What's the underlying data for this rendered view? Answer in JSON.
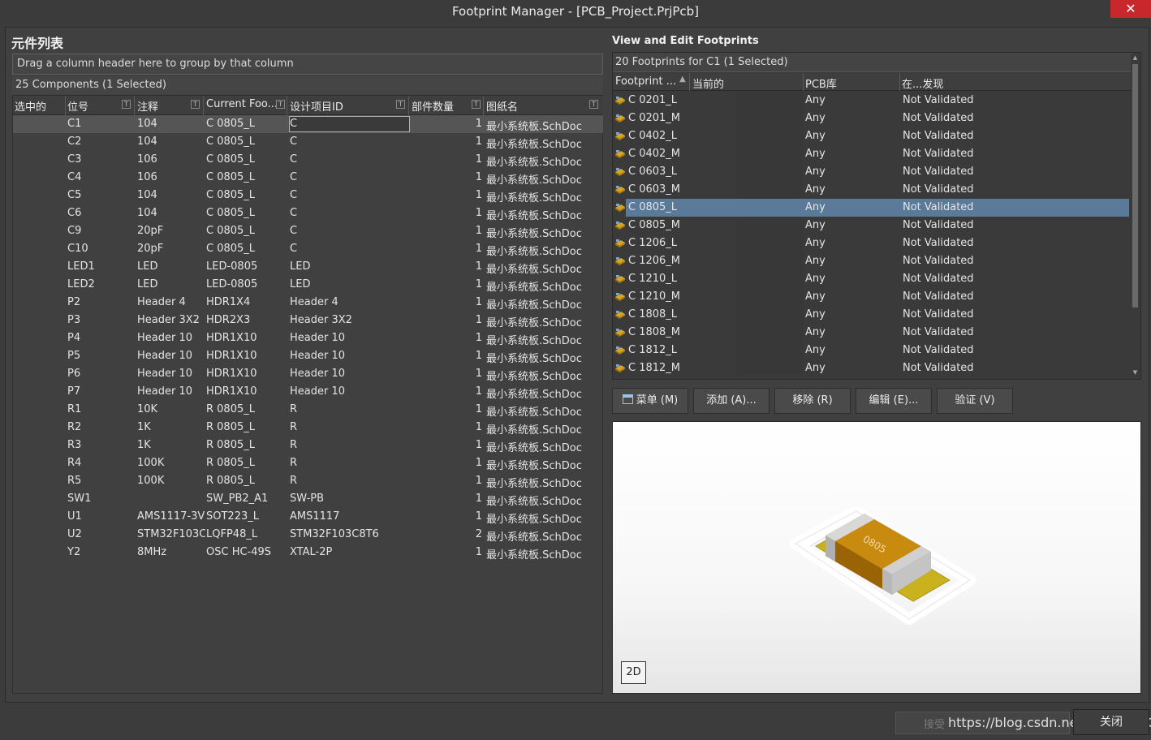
{
  "window": {
    "title": "Footprint Manager - [PCB_Project.PrjPcb]",
    "close_glyph": "✕"
  },
  "left": {
    "heading": "元件列表",
    "group_hint": "Drag a column header here to group by that column",
    "count": "25 Components (1 Selected)",
    "columns": [
      "选中的",
      "位号",
      "注释",
      "Current Foo...",
      "设计项目ID",
      "部件数量",
      "图纸名"
    ],
    "rows": [
      [
        "",
        "C1",
        "104",
        "C 0805_L",
        "C",
        "1",
        "最小系统板.SchDoc"
      ],
      [
        "",
        "C2",
        "104",
        "C 0805_L",
        "C",
        "1",
        "最小系统板.SchDoc"
      ],
      [
        "",
        "C3",
        "106",
        "C 0805_L",
        "C",
        "1",
        "最小系统板.SchDoc"
      ],
      [
        "",
        "C4",
        "106",
        "C 0805_L",
        "C",
        "1",
        "最小系统板.SchDoc"
      ],
      [
        "",
        "C5",
        "104",
        "C 0805_L",
        "C",
        "1",
        "最小系统板.SchDoc"
      ],
      [
        "",
        "C6",
        "104",
        "C 0805_L",
        "C",
        "1",
        "最小系统板.SchDoc"
      ],
      [
        "",
        "C9",
        "20pF",
        "C 0805_L",
        "C",
        "1",
        "最小系统板.SchDoc"
      ],
      [
        "",
        "C10",
        "20pF",
        "C 0805_L",
        "C",
        "1",
        "最小系统板.SchDoc"
      ],
      [
        "",
        "LED1",
        "LED",
        "LED-0805",
        "LED",
        "1",
        "最小系统板.SchDoc"
      ],
      [
        "",
        "LED2",
        "LED",
        "LED-0805",
        "LED",
        "1",
        "最小系统板.SchDoc"
      ],
      [
        "",
        "P2",
        "Header 4",
        "HDR1X4",
        "Header 4",
        "1",
        "最小系统板.SchDoc"
      ],
      [
        "",
        "P3",
        "Header 3X2",
        "HDR2X3",
        "Header 3X2",
        "1",
        "最小系统板.SchDoc"
      ],
      [
        "",
        "P4",
        "Header 10",
        "HDR1X10",
        "Header 10",
        "1",
        "最小系统板.SchDoc"
      ],
      [
        "",
        "P5",
        "Header 10",
        "HDR1X10",
        "Header 10",
        "1",
        "最小系统板.SchDoc"
      ],
      [
        "",
        "P6",
        "Header 10",
        "HDR1X10",
        "Header 10",
        "1",
        "最小系统板.SchDoc"
      ],
      [
        "",
        "P7",
        "Header 10",
        "HDR1X10",
        "Header 10",
        "1",
        "最小系统板.SchDoc"
      ],
      [
        "",
        "R1",
        "10K",
        "R 0805_L",
        "R",
        "1",
        "最小系统板.SchDoc"
      ],
      [
        "",
        "R2",
        "1K",
        "R 0805_L",
        "R",
        "1",
        "最小系统板.SchDoc"
      ],
      [
        "",
        "R3",
        "1K",
        "R 0805_L",
        "R",
        "1",
        "最小系统板.SchDoc"
      ],
      [
        "",
        "R4",
        "100K",
        "R 0805_L",
        "R",
        "1",
        "最小系统板.SchDoc"
      ],
      [
        "",
        "R5",
        "100K",
        "R 0805_L",
        "R",
        "1",
        "最小系统板.SchDoc"
      ],
      [
        "",
        "SW1",
        "",
        "SW_PB2_A1",
        "SW-PB",
        "1",
        "最小系统板.SchDoc"
      ],
      [
        "",
        "U1",
        "AMS1117-3V",
        "SOT223_L",
        "AMS1117",
        "1",
        "最小系统板.SchDoc"
      ],
      [
        "",
        "U2",
        "STM32F103C",
        "LQFP48_L",
        "STM32F103C8T6",
        "2",
        "最小系统板.SchDoc"
      ],
      [
        "",
        "Y2",
        "8MHz",
        "OSC HC-49S",
        "XTAL-2P",
        "1",
        "最小系统板.SchDoc"
      ]
    ]
  },
  "right": {
    "heading": "View and Edit Footprints",
    "count": "20 Footprints for C1 (1 Selected)",
    "columns": [
      "Footprint ...",
      "当前的",
      "PCB库",
      "在...发现"
    ],
    "rows": [
      [
        "C 0201_L",
        "Any",
        "Not Validated"
      ],
      [
        "C 0201_M",
        "Any",
        "Not Validated"
      ],
      [
        "C 0402_L",
        "Any",
        "Not Validated"
      ],
      [
        "C 0402_M",
        "Any",
        "Not Validated"
      ],
      [
        "C 0603_L",
        "Any",
        "Not Validated"
      ],
      [
        "C 0603_M",
        "Any",
        "Not Validated"
      ],
      [
        "C 0805_L",
        "Any",
        "Not Validated"
      ],
      [
        "C 0805_M",
        "Any",
        "Not Validated"
      ],
      [
        "C 1206_L",
        "Any",
        "Not Validated"
      ],
      [
        "C 1206_M",
        "Any",
        "Not Validated"
      ],
      [
        "C 1210_L",
        "Any",
        "Not Validated"
      ],
      [
        "C 1210_M",
        "Any",
        "Not Validated"
      ],
      [
        "C 1808_L",
        "Any",
        "Not Validated"
      ],
      [
        "C 1808_M",
        "Any",
        "Not Validated"
      ],
      [
        "C 1812_L",
        "Any",
        "Not Validated"
      ],
      [
        "C 1812_M",
        "Any",
        "Not Validated"
      ]
    ],
    "buttons": {
      "menu": "菜单 (M)",
      "add": "添加 (A)...",
      "remove": "移除 (R)",
      "edit": "编辑 (E)...",
      "validate": "验证 (V)"
    },
    "preview": {
      "mode_button": "2D",
      "chip_label": "0805"
    }
  },
  "footer": {
    "close": "关闭",
    "watermark": "https://blog.csdn.net/Ruffian_TOM",
    "watermark_faded": "接受"
  },
  "colors": {
    "selection": "#5b7a99",
    "close_red": "#c8272b",
    "chip_body": "#b8780a"
  }
}
